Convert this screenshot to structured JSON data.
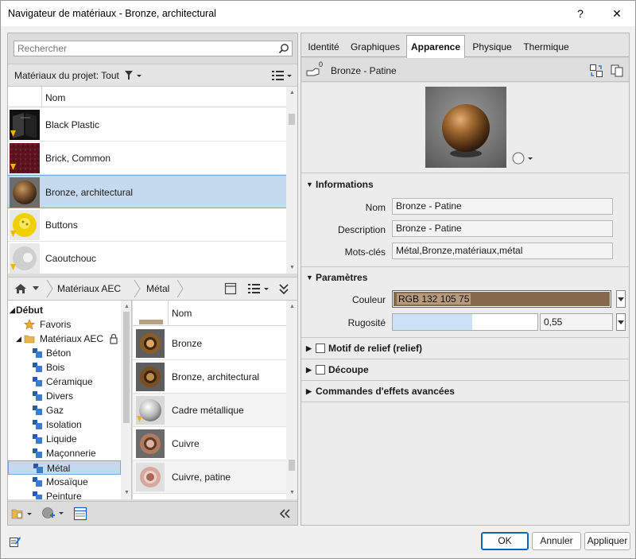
{
  "window": {
    "title": "Navigateur de matériaux - Bronze, architectural",
    "help_label": "?",
    "close_label": "✕"
  },
  "search": {
    "placeholder": "Rechercher"
  },
  "project": {
    "label": "Matériaux du projet: Tout",
    "column_header": "Nom",
    "items": [
      {
        "name": "Black Plastic",
        "icon": "black-plastic-thumbnail",
        "selected": false
      },
      {
        "name": "Brick, Common",
        "icon": "brick-thumbnail",
        "selected": false
      },
      {
        "name": "Bronze, architectural",
        "icon": "bronze-sphere-thumbnail",
        "selected": true
      },
      {
        "name": "Buttons",
        "icon": "yellow-buttons-thumbnail",
        "selected": false
      },
      {
        "name": "Caoutchouc",
        "icon": "rubber-thumbnail",
        "selected": false
      }
    ]
  },
  "library_bar": {
    "home_icon": "home-icon",
    "crumb1": "Matériaux AEC",
    "crumb2": "Métal"
  },
  "tree": {
    "root": "Début",
    "favorites": "Favoris",
    "library": "Matériaux AEC",
    "categories": [
      "Béton",
      "Bois",
      "Céramique",
      "Divers",
      "Gaz",
      "Isolation",
      "Liquide",
      "Maçonnerie",
      "Métal",
      "Mosaïque",
      "Peinture"
    ],
    "selected": "Métal"
  },
  "library_list": {
    "column_header": "Nom",
    "items": [
      {
        "name": "Bronze",
        "icon": "bronze-ring-thumbnail"
      },
      {
        "name": "Bronze, architectural",
        "icon": "bronze-ring-thumbnail"
      },
      {
        "name": "Cadre métallique",
        "icon": "metal-sphere-thumbnail"
      },
      {
        "name": "Cuivre",
        "icon": "copper-ring-thumbnail"
      },
      {
        "name": "Cuivre, patine",
        "icon": "copper-patina-thumbnail"
      }
    ]
  },
  "tabs": [
    {
      "label": "Identité",
      "active": false
    },
    {
      "label": "Graphiques",
      "active": false
    },
    {
      "label": "Apparence",
      "active": true
    },
    {
      "label": "Physique",
      "active": false
    },
    {
      "label": "Thermique",
      "active": false
    }
  ],
  "asset": {
    "count": "0",
    "name": "Bronze - Patine"
  },
  "informations": {
    "title": "Informations",
    "nom_label": "Nom",
    "nom_value": "Bronze - Patine",
    "description_label": "Description",
    "description_value": "Bronze - Patine",
    "motscles_label": "Mots-clés",
    "motscles_value": "Métal,Bronze,matériaux,métal"
  },
  "parametres": {
    "title": "Paramètres",
    "couleur_label": "Couleur",
    "couleur_value": "RGB 132 105 75",
    "couleur_hex": "#84694b",
    "rugosite_label": "Rugosité",
    "rugosite_value": "0,55",
    "rugosite_fraction": 0.55
  },
  "sections": {
    "relief": "Motif de relief (relief)",
    "decoupe": "Découpe",
    "effets": "Commandes d'effets avancées"
  },
  "buttons": {
    "ok": "OK",
    "annuler": "Annuler",
    "appliquer": "Appliquer"
  }
}
